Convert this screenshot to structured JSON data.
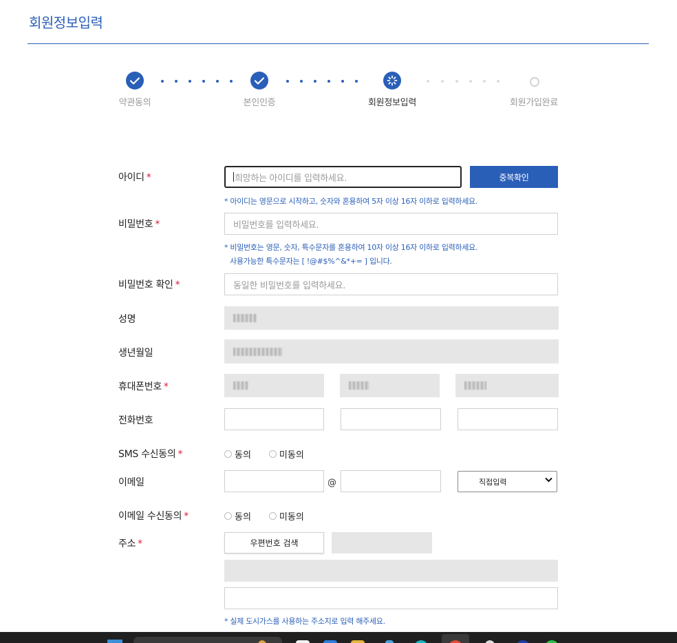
{
  "page": {
    "title": "회원정보입력"
  },
  "steps": [
    {
      "label": "약관동의",
      "status": "done"
    },
    {
      "label": "본인인증",
      "status": "done"
    },
    {
      "label": "회원정보입력",
      "status": "current"
    },
    {
      "label": "회원가입완료",
      "status": "pending"
    }
  ],
  "form": {
    "id": {
      "label": "아이디",
      "required_mark": "*",
      "placeholder": "희망하는 아이디를 입력하세요.",
      "check_button": "중복확인",
      "hint": "* 아이디는 영문으로 시작하고, 숫자와 혼용하여 5자 이상 16자 이하로 입력하세요."
    },
    "password": {
      "label": "비밀번호",
      "required_mark": "*",
      "placeholder": "비밀번호를 입력하세요.",
      "hint_line1": "* 비밀번호는 영문, 숫자, 특수문자를 혼용하여 10자 이상 16자 이하로 입력하세요.",
      "hint_line2": "사용가능한 특수문자는 [ !@#$%^&*+= ] 입니다."
    },
    "password_confirm": {
      "label": "비밀번호 확인",
      "required_mark": "*",
      "placeholder": "동일한 비밀번호를 입력하세요."
    },
    "name": {
      "label": "성명"
    },
    "birthdate": {
      "label": "생년월일"
    },
    "mobile": {
      "label": "휴대폰번호",
      "required_mark": "*"
    },
    "phone": {
      "label": "전화번호"
    },
    "sms_consent": {
      "label": "SMS 수신동의",
      "required_mark": "*",
      "options": [
        "동의",
        "미동의"
      ]
    },
    "email": {
      "label": "이메일",
      "at_symbol": "@",
      "domain_select": "직접입력"
    },
    "email_consent": {
      "label": "이메일 수신동의",
      "required_mark": "*",
      "options": [
        "동의",
        "미동의"
      ]
    },
    "address": {
      "label": "주소",
      "required_mark": "*",
      "search_button": "우편번호 검색",
      "hint": "* 실제 도시가스를 사용하는 주소지로 입력 해주세요."
    }
  },
  "colors": {
    "accent": "#2a5fb8",
    "required": "#d81b3a",
    "readonly_fill": "#e6e6e6"
  }
}
